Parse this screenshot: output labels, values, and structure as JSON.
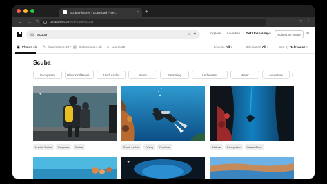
{
  "browser": {
    "tab_title": "Scuba Pictures | Download Free...",
    "tab_close": "×",
    "new_tab": "+",
    "url_domain": "unsplash.com",
    "url_path": "/s/photos/scuba",
    "nav": {
      "back": "←",
      "forward": "→",
      "reload": "↻"
    },
    "toolbar_icons": {
      "extensions": "⬚",
      "menu": "⋮"
    }
  },
  "header": {
    "search_value": "scuba",
    "search_clear": "×",
    "visual_search": "⌗",
    "links": [
      "Explore",
      "Advertise"
    ],
    "unsplash_plus": "Get Unsplash+",
    "login": "Log in",
    "submit": "Submit an image",
    "menu": "≡"
  },
  "subnav": {
    "tabs": [
      {
        "icon": "▣",
        "label": "Photos 1k"
      },
      {
        "icon": "✎",
        "label": "Illustrations 487"
      },
      {
        "icon": "▤",
        "label": "Collections 4.5k"
      },
      {
        "icon": "☺",
        "label": "Users 38"
      }
    ],
    "filters": [
      {
        "label": "License",
        "value": "All"
      },
      {
        "label": "Orientation",
        "value": "All"
      },
      {
        "label": "Sort by",
        "value": "Relevance"
      }
    ]
  },
  "page": {
    "title": "Scuba"
  },
  "chips": [
    "Ecosystem",
    "Islands Of Reoni...",
    "Saudi Arabia",
    "Neom",
    "Swimming",
    "Underwater",
    "Water",
    "Adventure"
  ],
  "chip_next": "›",
  "photos": [
    {
      "tags": [
        "Marine Police",
        "Frogman",
        "Police"
      ]
    },
    {
      "tags": [
        "Saudi Arabia",
        "Diving",
        "Outdoors"
      ]
    },
    {
      "tags": [
        "Nature",
        "Ecosystem",
        "Ocean Floor"
      ]
    }
  ],
  "colors": {
    "accent": "#111111",
    "tab_active": "#111111"
  }
}
